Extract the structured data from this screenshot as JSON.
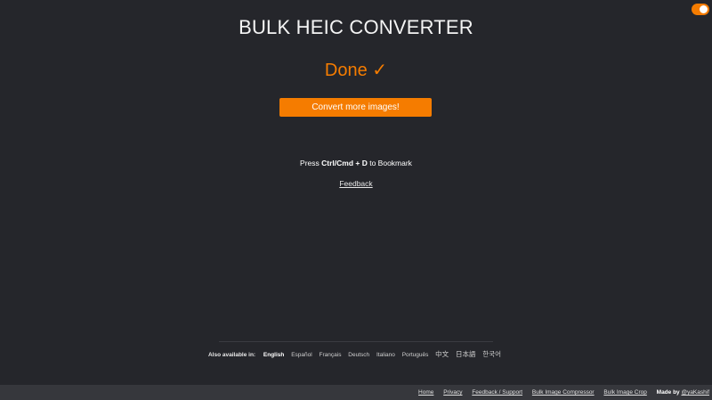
{
  "header": {
    "title": "BULK HEIC CONVERTER"
  },
  "status": {
    "done_text": "Done ✓"
  },
  "actions": {
    "convert_more_label": "Convert more images!"
  },
  "bookmark": {
    "prefix": "Press ",
    "shortcut": "Ctrl/Cmd + D",
    "suffix": " to Bookmark"
  },
  "feedback": {
    "label": "Feedback"
  },
  "languages": {
    "label": "Also available in:",
    "items": [
      {
        "label": "English"
      },
      {
        "label": "Español"
      },
      {
        "label": "Français"
      },
      {
        "label": "Deutsch"
      },
      {
        "label": "Italiano"
      },
      {
        "label": "Português"
      },
      {
        "label": "中文"
      },
      {
        "label": "日本語"
      },
      {
        "label": "한국어"
      }
    ]
  },
  "footer": {
    "links": [
      {
        "label": "Home"
      },
      {
        "label": "Privacy"
      },
      {
        "label": "Feedback / Support"
      },
      {
        "label": "Bulk Image Compressor"
      },
      {
        "label": "Bulk Image Crop"
      }
    ],
    "made_by_prefix": "Made by ",
    "made_by_handle": "@yaKashif"
  },
  "colors": {
    "accent": "#f57c00",
    "background": "#25262b",
    "footer_bg": "#36373c"
  },
  "icons": {
    "theme_toggle": "toggle-switch-icon"
  }
}
